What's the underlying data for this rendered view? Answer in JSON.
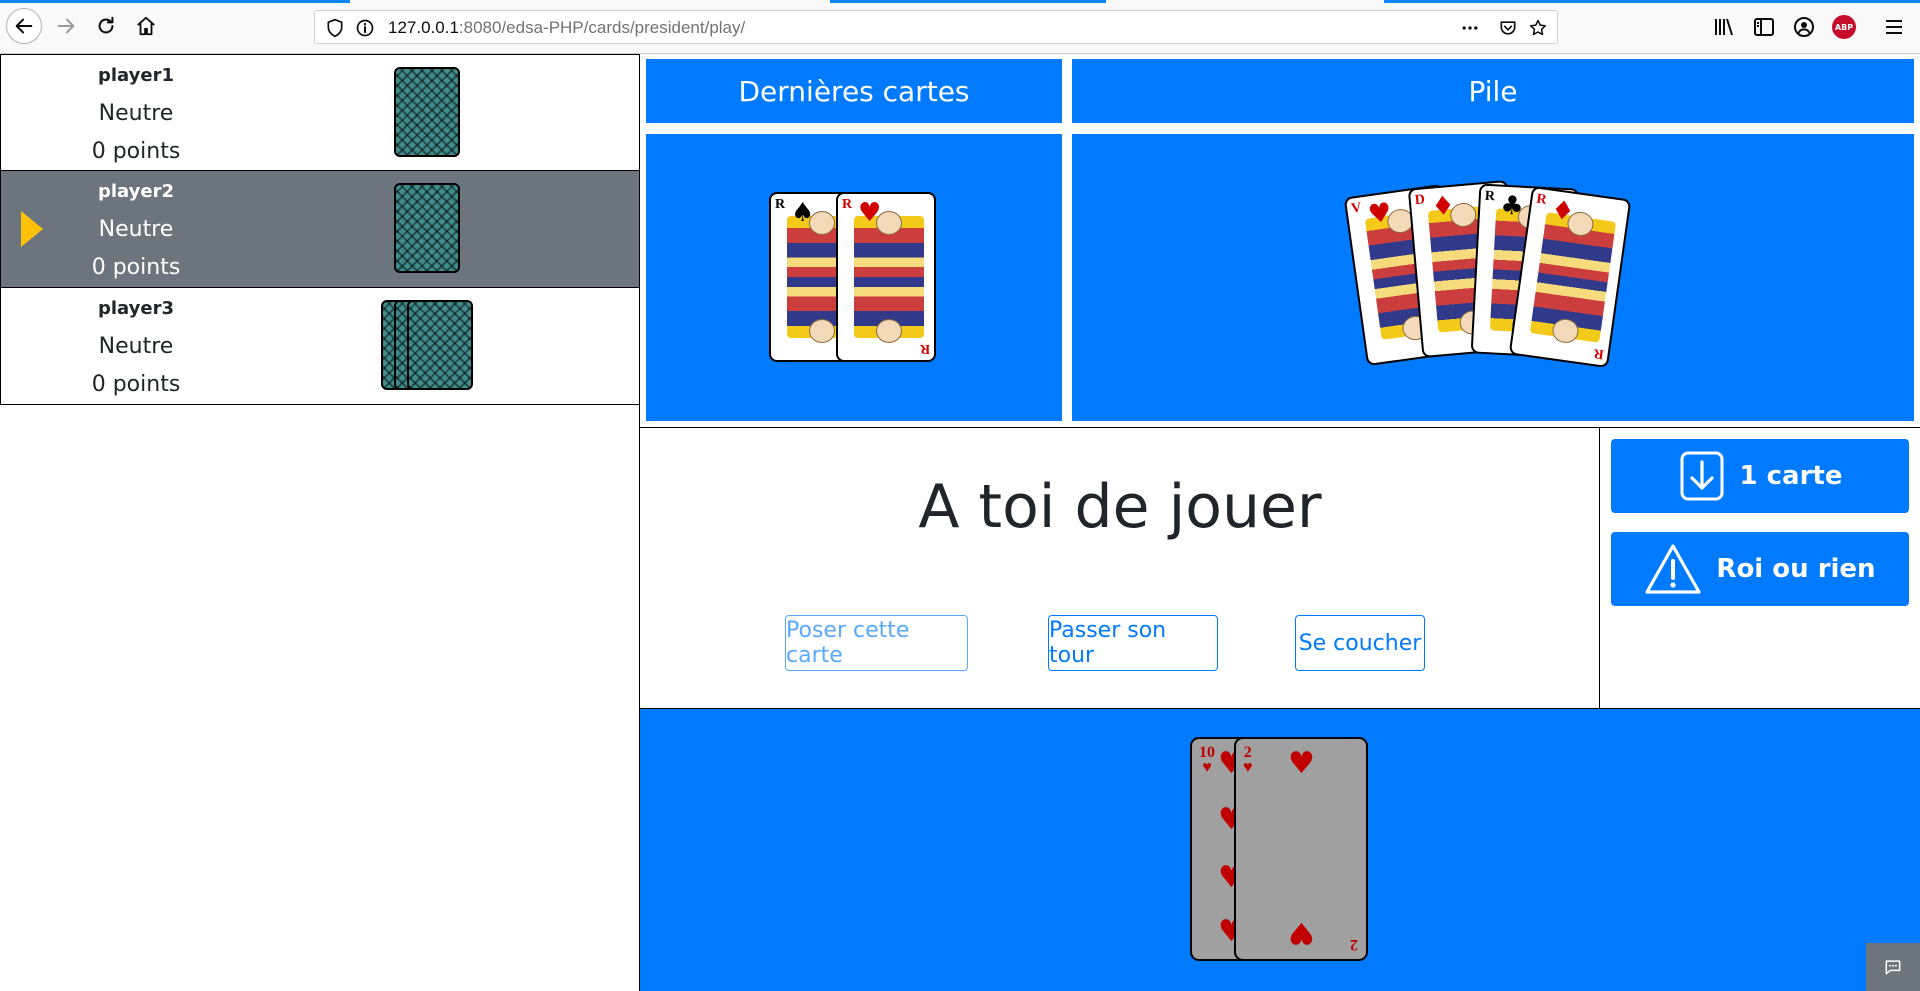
{
  "browser": {
    "url_host": "127.0.0.1",
    "url_path": ":8080/edsa-PHP/cards/president/play/",
    "abp_label": "ABP"
  },
  "players": [
    {
      "name": "player1",
      "status": "Neutre",
      "points": "0 points",
      "cards": 1,
      "active": false
    },
    {
      "name": "player2",
      "status": "Neutre",
      "points": "0 points",
      "cards": 1,
      "active": true
    },
    {
      "name": "player3",
      "status": "Neutre",
      "points": "0 points",
      "cards": 3,
      "active": false
    }
  ],
  "last_cards": {
    "title": "Dernières cartes",
    "cards": [
      {
        "rank": "R",
        "suit": "♠",
        "color": "black"
      },
      {
        "rank": "R",
        "suit": "♥",
        "color": "red"
      }
    ]
  },
  "pile": {
    "title": "Pile",
    "cards": [
      {
        "rank": "V",
        "suit": "♥",
        "color": "red"
      },
      {
        "rank": "D",
        "suit": "♦",
        "color": "red"
      },
      {
        "rank": "R",
        "suit": "♣",
        "color": "black"
      },
      {
        "rank": "R",
        "suit": "♦",
        "color": "red"
      }
    ]
  },
  "status": {
    "message": "A toi de jouer",
    "play_label": "Poser cette carte",
    "pass_label": "Passer son tour",
    "fold_label": "Se coucher"
  },
  "actions": {
    "draw_label": "1 carte",
    "king_label": "Roi ou rien"
  },
  "hand": {
    "cards": [
      {
        "rank": "10",
        "suit": "♥"
      },
      {
        "rank": "2",
        "suit": "♥"
      }
    ]
  },
  "colors": {
    "primary": "#007bff",
    "active_row": "#6c757d",
    "arrow": "#ffc107"
  }
}
